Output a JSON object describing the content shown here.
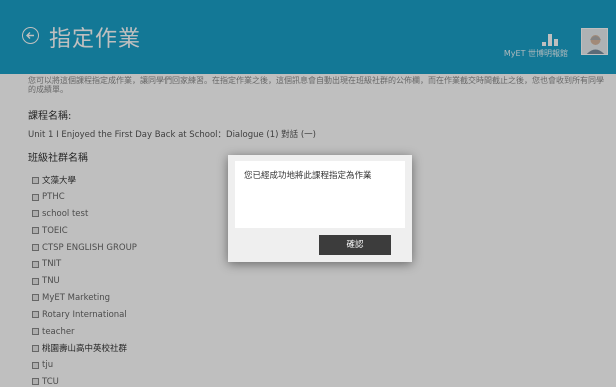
{
  "header": {
    "title": "指定作業",
    "user_label": "MyET 世博明報館",
    "back_icon": "back-arrow-circle-icon",
    "avatar_icon": "user-avatar-icon"
  },
  "content": {
    "intro_text": "您可以將這個課程指定成作業，讓同學們回家練習。在指定作業之後，這個訊息會自動出現在班級社群的公佈欄，而在作業截交時間截止之後，您也會收到所有同學的成績單。",
    "course_label": "課程名稱:",
    "course_name": "Unit 1 I Enjoyed the First Day Back at School：Dialogue (1)  對話 (一)",
    "groups_label": "班級社群名稱",
    "groups": [
      {
        "name": "文藻大學",
        "dark": true
      },
      {
        "name": "PTHC",
        "dark": false
      },
      {
        "name": "school test",
        "dark": false
      },
      {
        "name": "TOEIC",
        "dark": false
      },
      {
        "name": "CTSP ENGLISH GROUP",
        "dark": false
      },
      {
        "name": "TNIT",
        "dark": false
      },
      {
        "name": "TNU",
        "dark": false
      },
      {
        "name": "MyET Marketing",
        "dark": false
      },
      {
        "name": "Rotary International",
        "dark": false
      },
      {
        "name": "teacher",
        "dark": false
      },
      {
        "name": "桃園壽山高中英校社群",
        "dark": true
      },
      {
        "name": "tju",
        "dark": false
      },
      {
        "name": "TCU",
        "dark": false
      }
    ]
  },
  "dialog": {
    "message": "您已經成功地將此課程指定為作業",
    "confirm_label": "確認"
  },
  "colors": {
    "header_bg": "#1aa1c8",
    "button_bg": "#3c3c3c"
  }
}
